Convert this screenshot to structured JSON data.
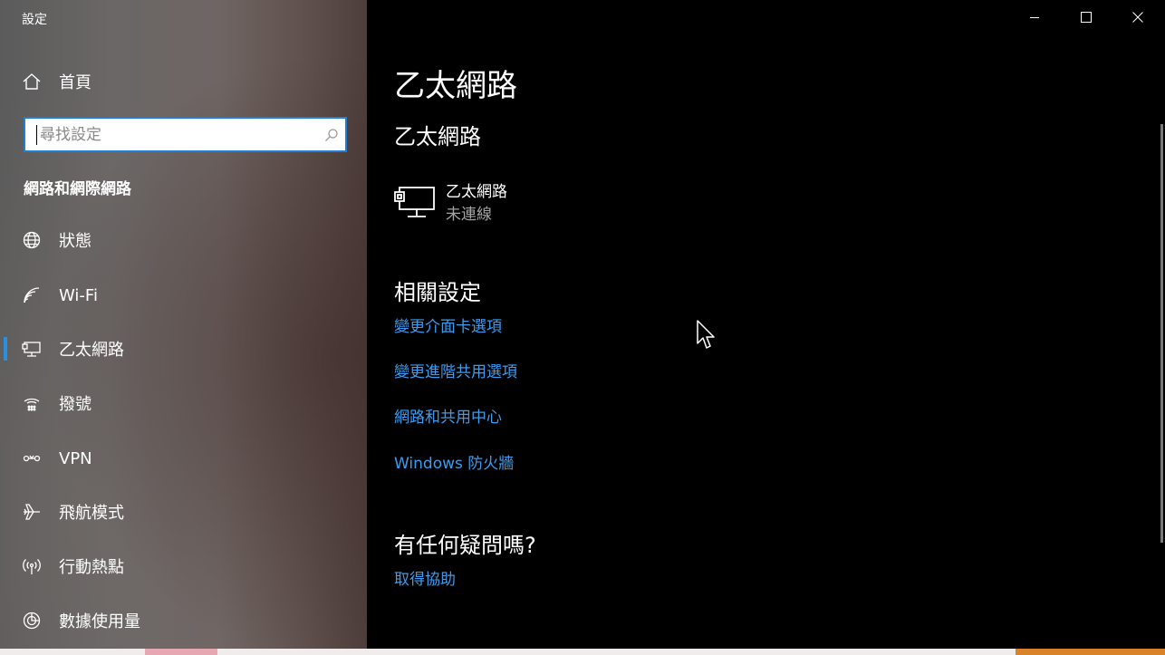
{
  "window": {
    "title": "設定",
    "minimize_icon": "minimize-icon",
    "maximize_icon": "maximize-icon",
    "close_icon": "close-icon"
  },
  "sidebar": {
    "home": {
      "label": "首頁",
      "icon": "home-icon"
    },
    "search": {
      "placeholder": "尋找設定",
      "value": "",
      "icon": "search-icon"
    },
    "section_heading": "網路和網際網路",
    "items": [
      {
        "label": "狀態",
        "icon": "globe-status-icon"
      },
      {
        "label": "Wi-Fi",
        "icon": "wifi-icon"
      },
      {
        "label": "乙太網路",
        "icon": "ethernet-icon",
        "selected": true
      },
      {
        "label": "撥號",
        "icon": "dialup-icon"
      },
      {
        "label": "VPN",
        "icon": "vpn-icon"
      },
      {
        "label": "飛航模式",
        "icon": "airplane-icon"
      },
      {
        "label": "行動熱點",
        "icon": "hotspot-icon"
      },
      {
        "label": "數據使用量",
        "icon": "data-usage-icon"
      }
    ],
    "accent_color": "#2b8fe0"
  },
  "main": {
    "page_title": "乙太網路",
    "sub_title": "乙太網路",
    "network": {
      "name": "乙太網路",
      "status": "未連線",
      "icon": "ethernet-monitor-icon"
    },
    "related_heading": "相關設定",
    "related_links": [
      "變更介面卡選項",
      "變更進階共用選項",
      "網路和共用中心",
      "Windows 防火牆"
    ],
    "help_heading": "有任何疑問嗎?",
    "help_link": "取得協助",
    "link_color": "#3b9cf0"
  }
}
